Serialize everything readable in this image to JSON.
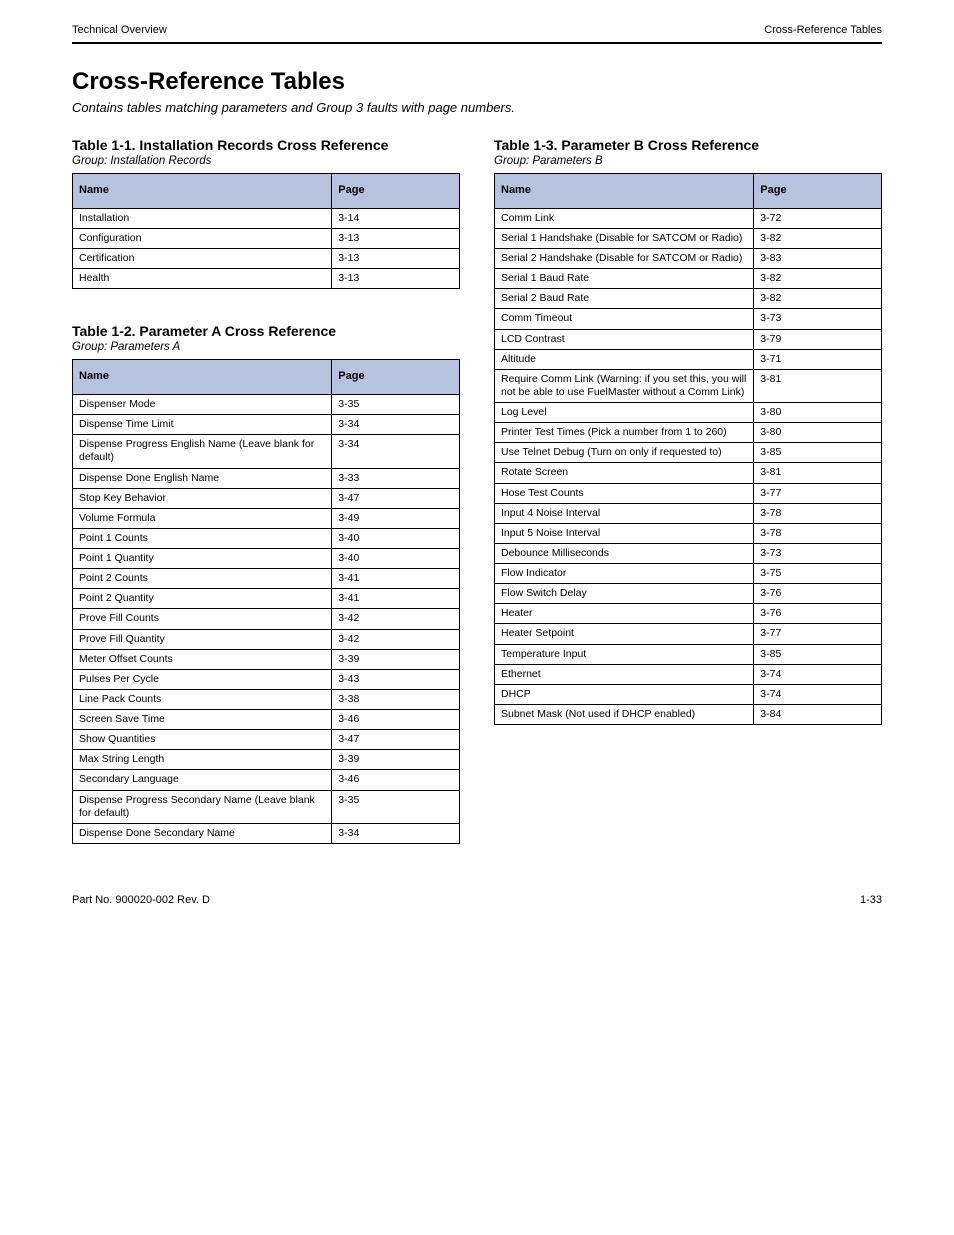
{
  "running_head": {
    "left": "Technical Overview",
    "right": "Cross-Reference Tables"
  },
  "section": {
    "title": "Cross-Reference Tables",
    "subtitle": "Contains tables matching parameters and Group 3 faults with page numbers."
  },
  "columns": {
    "name_header": "Name",
    "page_header": "Page"
  },
  "tables": [
    {
      "title": "Table 1-1. Installation Records Cross Reference",
      "subtitle": "Group: Installation Records",
      "rows": [
        {
          "name": "Installation",
          "page": "3-14"
        },
        {
          "name": "Configuration",
          "page": "3-13"
        },
        {
          "name": "Certification",
          "page": "3-13"
        },
        {
          "name": "Health",
          "page": "3-13"
        }
      ]
    },
    {
      "title": "Table 1-2. Parameter A Cross Reference",
      "subtitle": "Group: Parameters A",
      "rows": [
        {
          "name": "Dispenser Mode",
          "page": "3-35"
        },
        {
          "name": "Dispense Time Limit",
          "page": "3-34"
        },
        {
          "name": "Dispense Progress English Name (Leave blank for default)",
          "page": "3-34"
        },
        {
          "name": "Dispense Done English Name",
          "page": "3-33"
        },
        {
          "name": "Stop Key Behavior",
          "page": "3-47"
        },
        {
          "name": "Volume Formula",
          "page": "3-49"
        },
        {
          "name": "Point 1 Counts",
          "page": "3-40"
        },
        {
          "name": "Point 1 Quantity",
          "page": "3-40"
        },
        {
          "name": "Point 2 Counts",
          "page": "3-41"
        },
        {
          "name": "Point 2 Quantity",
          "page": "3-41"
        },
        {
          "name": "Prove Fill Counts",
          "page": "3-42"
        },
        {
          "name": "Prove Fill Quantity",
          "page": "3-42"
        },
        {
          "name": "Meter Offset Counts",
          "page": "3-39"
        },
        {
          "name": "Pulses Per Cycle",
          "page": "3-43"
        },
        {
          "name": "Line Pack Counts",
          "page": "3-38"
        },
        {
          "name": "Screen Save Time",
          "page": "3-46"
        },
        {
          "name": "Show Quantities",
          "page": "3-47"
        },
        {
          "name": "Max String Length",
          "page": "3-39"
        },
        {
          "name": "Secondary Language",
          "page": "3-46"
        },
        {
          "name": "Dispense Progress Secondary Name (Leave blank for default)",
          "page": "3-35"
        },
        {
          "name": "Dispense Done Secondary Name",
          "page": "3-34"
        }
      ]
    },
    {
      "title": "Table 1-3. Parameter B Cross Reference",
      "subtitle": "Group: Parameters B",
      "rows": [
        {
          "name": "Comm Link",
          "page": "3-72"
        },
        {
          "name": "Serial 1 Handshake (Disable for SATCOM or Radio)",
          "page": "3-82"
        },
        {
          "name": "Serial 2 Handshake (Disable for SATCOM or Radio)",
          "page": "3-83"
        },
        {
          "name": "Serial 1 Baud Rate",
          "page": "3-82"
        },
        {
          "name": "Serial 2 Baud Rate",
          "page": "3-82"
        },
        {
          "name": "Comm Timeout",
          "page": "3-73"
        },
        {
          "name": "LCD Contrast",
          "page": "3-79"
        },
        {
          "name": "Altitude",
          "page": "3-71"
        },
        {
          "name": "Require Comm Link (Warning: if you set this, you will not be able to use FuelMaster without a Comm Link)",
          "page": "3-81"
        },
        {
          "name": "Log Level",
          "page": "3-80"
        },
        {
          "name": "Printer Test Times (Pick a number from 1 to 260)",
          "page": "3-80"
        },
        {
          "name": "Use Telnet Debug (Turn on only if requested to)",
          "page": "3-85"
        },
        {
          "name": "Rotate Screen",
          "page": "3-81"
        },
        {
          "name": "Hose Test Counts",
          "page": "3-77"
        },
        {
          "name": "Input 4 Noise Interval",
          "page": "3-78"
        },
        {
          "name": "Input 5 Noise Interval",
          "page": "3-78"
        },
        {
          "name": "Debounce Milliseconds",
          "page": "3-73"
        },
        {
          "name": "Flow Indicator",
          "page": "3-75"
        },
        {
          "name": "Flow Switch Delay",
          "page": "3-76"
        },
        {
          "name": "Heater",
          "page": "3-76"
        },
        {
          "name": "Heater Setpoint",
          "page": "3-77"
        },
        {
          "name": "Temperature Input",
          "page": "3-85"
        },
        {
          "name": "Ethernet",
          "page": "3-74"
        },
        {
          "name": "DHCP",
          "page": "3-74"
        },
        {
          "name": "Subnet Mask (Not used if DHCP enabled)",
          "page": "3-84"
        }
      ]
    }
  ],
  "footer": {
    "part": "Part No. 900020-002 Rev. D",
    "page": "1-33"
  }
}
